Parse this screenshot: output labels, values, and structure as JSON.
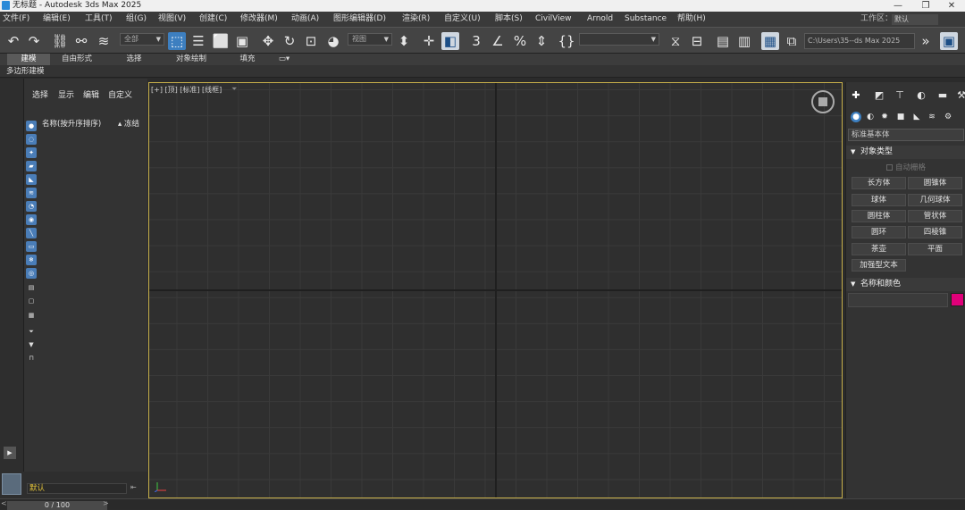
{
  "window": {
    "title": "无标题 - Autodesk 3ds Max 2025",
    "minimize": "—",
    "maximize": "❐",
    "close": "✕"
  },
  "menu": {
    "items": [
      "文件(F)",
      "编辑(E)",
      "工具(T)",
      "组(G)",
      "视图(V)",
      "创建(C)",
      "修改器(M)",
      "动画(A)",
      "图形编辑器(D)",
      "渲染(R)",
      "自定义(U)",
      "脚本(S)",
      "CivilView",
      "Arnold",
      "Substance",
      "帮助(H)"
    ],
    "workspace_label": "工作区：",
    "workspace_value": "默认"
  },
  "toolbar": {
    "selection_filter": "全部",
    "reference_coord": "视图",
    "named_selection": "",
    "project_path": "C:\\Users\\35--ds Max 2025",
    "more": "»"
  },
  "ribbon": {
    "tabs": [
      "建模",
      "自由形式",
      "选择",
      "对象绘制",
      "填充"
    ],
    "active_tab": "建模",
    "subpanel": "多边形建模"
  },
  "explorer": {
    "menu": [
      "选择",
      "显示",
      "编辑",
      "自定义"
    ],
    "col_name": "名称(按升序排序)",
    "col_frozen": "▴ 冻结"
  },
  "layer": {
    "name": "默认"
  },
  "timeline": {
    "frame": "0 / 100",
    "prev": "<",
    "next": ">"
  },
  "viewport": {
    "label": "[+] [顶] [标准] [线框]",
    "filter_icon": "filter-icon"
  },
  "command_panel": {
    "category_dropdown": "标准基本体",
    "rollout_object_type": "对象类型",
    "autogrid": "自动栅格",
    "buttons": [
      "长方体",
      "圆锥体",
      "球体",
      "几何球体",
      "圆柱体",
      "管状体",
      "圆环",
      "四棱锥",
      "茶壶",
      "平面",
      "加强型文本"
    ],
    "rollout_name_color": "名称和颜色",
    "object_color": "#e0007a"
  },
  "colors": {
    "accent": "#3d7fc0",
    "viewport_border": "#c8b04a",
    "layer_text": "#e0c13a"
  }
}
